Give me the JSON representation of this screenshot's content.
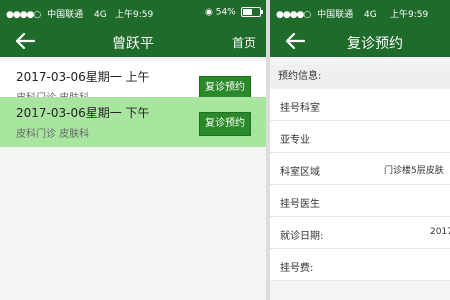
{
  "left": {
    "status": {
      "carrier": "中国联通",
      "network": "4G",
      "time": "上午9:59",
      "battery": "54%",
      "battery_level": 0.54
    },
    "nav": {
      "title": "曾跃平",
      "right": "首页"
    },
    "appointments": [
      {
        "date": "2017-03-06星期一 上午",
        "dept": "皮科门诊 皮肤科",
        "button": "复诊预约"
      },
      {
        "date": "2017-03-06星期一 下午",
        "dept": "皮科门诊 皮肤科",
        "button": "复诊预约"
      }
    ]
  },
  "right": {
    "status": {
      "carrier": "中国联通",
      "network": "4G",
      "time": "上午9:59"
    },
    "nav": {
      "title": "复诊预约"
    },
    "info_header": "预约信息:",
    "rows": [
      {
        "label": "挂号科室",
        "value": ""
      },
      {
        "label": "亚专业",
        "value": ""
      },
      {
        "label": "科室区域",
        "value": "门诊楼5层皮肤"
      },
      {
        "label": "挂号医生",
        "value": ""
      },
      {
        "label": "就诊日期:",
        "value": "2017"
      },
      {
        "label": "挂号费:",
        "value": ""
      }
    ]
  },
  "colors": {
    "header": "#1e6b2b",
    "selected_row": "#a8e6a0",
    "button": "#2a8a2a"
  }
}
